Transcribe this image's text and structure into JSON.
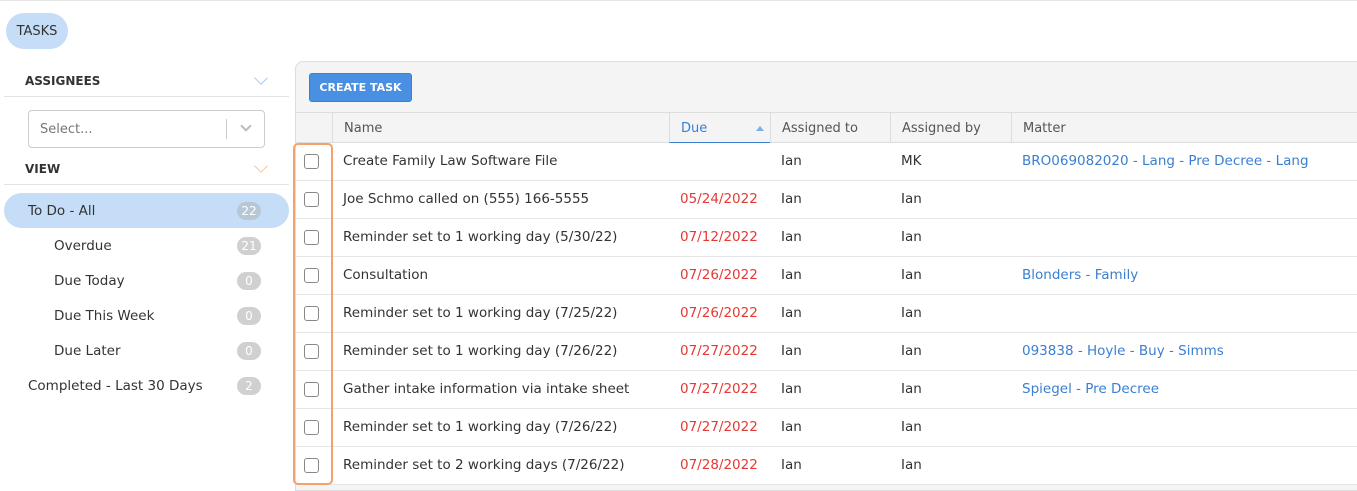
{
  "header": {
    "tab_label": "TASKS"
  },
  "sidebar": {
    "assignees_title": "ASSIGNEES",
    "assignees_select_placeholder": "Select...",
    "view_title": "VIEW",
    "views": [
      {
        "label": "To Do - All",
        "count": "22",
        "active": true,
        "indent": false
      },
      {
        "label": "Overdue",
        "count": "21",
        "indent": true
      },
      {
        "label": "Due Today",
        "count": "0",
        "indent": true
      },
      {
        "label": "Due This Week",
        "count": "0",
        "indent": true
      },
      {
        "label": "Due Later",
        "count": "0",
        "indent": true
      },
      {
        "label": "Completed - Last 30 Days",
        "count": "2",
        "indent": false
      }
    ]
  },
  "toolbar": {
    "create_label": "CREATE TASK"
  },
  "table": {
    "columns": [
      "Name",
      "Due",
      "Assigned to",
      "Assigned by",
      "Matter"
    ],
    "sort": {
      "column": "Due",
      "direction": "ascending"
    },
    "rows": [
      {
        "name": "Create Family Law Software File",
        "due": "",
        "to": "Ian",
        "by": "MK",
        "matter": "BRO069082020 - Lang - Pre Decree - Lang"
      },
      {
        "name": "Joe Schmo called on (555) 166-5555",
        "due": "05/24/2022",
        "to": "Ian",
        "by": "Ian",
        "matter": ""
      },
      {
        "name": "Reminder set to 1 working day (5/30/22)",
        "due": "07/12/2022",
        "to": "Ian",
        "by": "Ian",
        "matter": ""
      },
      {
        "name": "Consultation",
        "due": "07/26/2022",
        "to": "Ian",
        "by": "Ian",
        "matter": "Blonders - Family"
      },
      {
        "name": "Reminder set to 1 working day (7/25/22)",
        "due": "07/26/2022",
        "to": "Ian",
        "by": "Ian",
        "matter": ""
      },
      {
        "name": "Reminder set to 1 working day (7/26/22)",
        "due": "07/27/2022",
        "to": "Ian",
        "by": "Ian",
        "matter": "093838 - Hoyle - Buy - Simms"
      },
      {
        "name": "Gather intake information via intake sheet",
        "due": "07/27/2022",
        "to": "Ian",
        "by": "Ian",
        "matter": "Spiegel - Pre Decree"
      },
      {
        "name": "Reminder set to 1 working day (7/26/22)",
        "due": "07/27/2022",
        "to": "Ian",
        "by": "Ian",
        "matter": ""
      },
      {
        "name": "Reminder set to 2 working days (7/26/22)",
        "due": "07/28/2022",
        "to": "Ian",
        "by": "Ian",
        "matter": ""
      }
    ]
  },
  "colors": {
    "accent": "#4a90e2",
    "overdue": "#e53935",
    "active_bg": "#c5ddf6",
    "focus": "#f2a26a"
  }
}
